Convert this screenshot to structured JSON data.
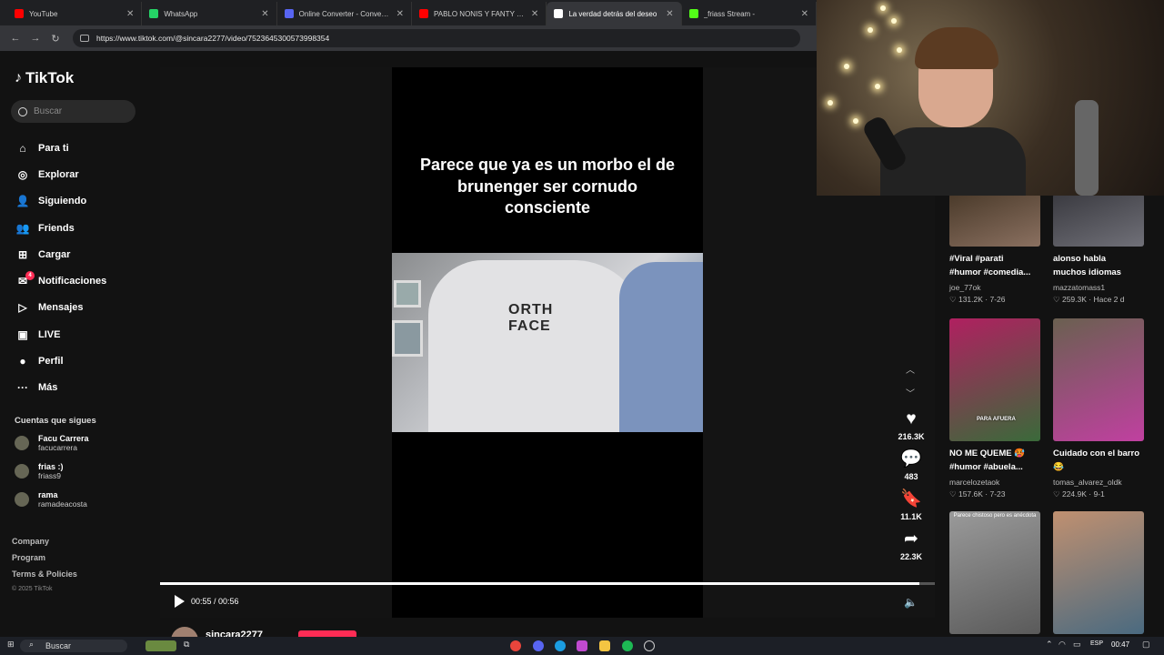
{
  "browser": {
    "tabs": [
      {
        "title": "YouTube",
        "color": "#ff0000"
      },
      {
        "title": "WhatsApp",
        "color": "#25d366"
      },
      {
        "title": "Online Converter - Convert Ima",
        "color": "#5865f2"
      },
      {
        "title": "PABLO NONIS Y FANTY ESCAV",
        "color": "#ff0000"
      },
      {
        "title": "La verdad detrás del deseo",
        "color": "#ffffff",
        "active": true
      },
      {
        "title": "_friass Stream -",
        "color": "#53fc18"
      }
    ],
    "url": "https://www.tiktok.com/@sincara2277/video/7523645300573998354"
  },
  "sidebar": {
    "logo": "TikTok",
    "search_placeholder": "Buscar",
    "menu": [
      {
        "label": "Para ti",
        "icon": "home-icon"
      },
      {
        "label": "Explorar",
        "icon": "compass-icon"
      },
      {
        "label": "Siguiendo",
        "icon": "following-icon"
      },
      {
        "label": "Friends",
        "icon": "friends-icon"
      },
      {
        "label": "Cargar",
        "icon": "upload-icon"
      },
      {
        "label": "Notificaciones",
        "icon": "bell-icon",
        "badge": "4"
      },
      {
        "label": "Mensajes",
        "icon": "message-icon"
      },
      {
        "label": "LIVE",
        "icon": "live-icon"
      },
      {
        "label": "Perfil",
        "icon": "profile-icon"
      },
      {
        "label": "Más",
        "icon": "more-icon"
      }
    ],
    "following_title": "Cuentas que sigues",
    "following": [
      {
        "name": "Facu Carrera",
        "handle": "facucarrera"
      },
      {
        "name": "frias :)",
        "handle": "friass9"
      },
      {
        "name": "rama",
        "handle": "ramadeacosta"
      }
    ],
    "footer": [
      "Company",
      "Program",
      "Terms & Policies"
    ],
    "copyright": "© 2025 TikTok"
  },
  "video": {
    "caption": "Parece que ya es un morbo el de brunenger ser cornudo consciente",
    "time": "00:55 / 00:56",
    "progress": 0.98,
    "hoodie_text": "ORTH\nFACE",
    "uploader": "sincara2277"
  },
  "actions": [
    {
      "icon": "heart-icon",
      "count": "216.3K"
    },
    {
      "icon": "comment-icon",
      "count": "483"
    },
    {
      "icon": "bookmark-icon",
      "count": "11.1K"
    },
    {
      "icon": "share-icon",
      "count": "22.3K"
    }
  ],
  "recommended": [
    {
      "title": "#Viral #parati",
      "title2": "#humor #comedia...",
      "author": "joe_77ok",
      "stats": "♡ 131.2K · 7-26",
      "colors": [
        "#4a3a2a",
        "#8a7060"
      ]
    },
    {
      "title": "alonso habla",
      "title2": "muchos idiomas",
      "author": "mazzatomass1",
      "stats": "♡ 259.3K · Hace 2 d",
      "colors": [
        "#3a3a40",
        "#707078"
      ]
    },
    {
      "title": "NO ME QUEME 🥵",
      "title2": "#humor #abuela...",
      "author": "marcelozetaok",
      "stats": "♡ 157.6K · 7-23",
      "colors": [
        "#b02060",
        "#3a6a3a"
      ]
    },
    {
      "title": "Cuidado con el barro",
      "title2": "😂",
      "author": "tomas_alvarez_oldk",
      "stats": "♡ 224.9K · 9-1",
      "colors": [
        "#6a6050",
        "#c040a0"
      ]
    },
    {
      "title": "",
      "title2": "",
      "author": "",
      "stats": "",
      "overlay": "Parece chistoso pero es anécdota",
      "colors": [
        "#9a9a9a",
        "#5a5a5a"
      ]
    },
    {
      "title": "",
      "title2": "",
      "author": "",
      "stats": "",
      "colors": [
        "#c09070",
        "#4a6a80"
      ]
    }
  ],
  "thumb_labels": {
    "para_afuera": "PARA AFUERA"
  },
  "taskbar": {
    "search": "Buscar",
    "lang": "ESP",
    "time": "00:47"
  }
}
